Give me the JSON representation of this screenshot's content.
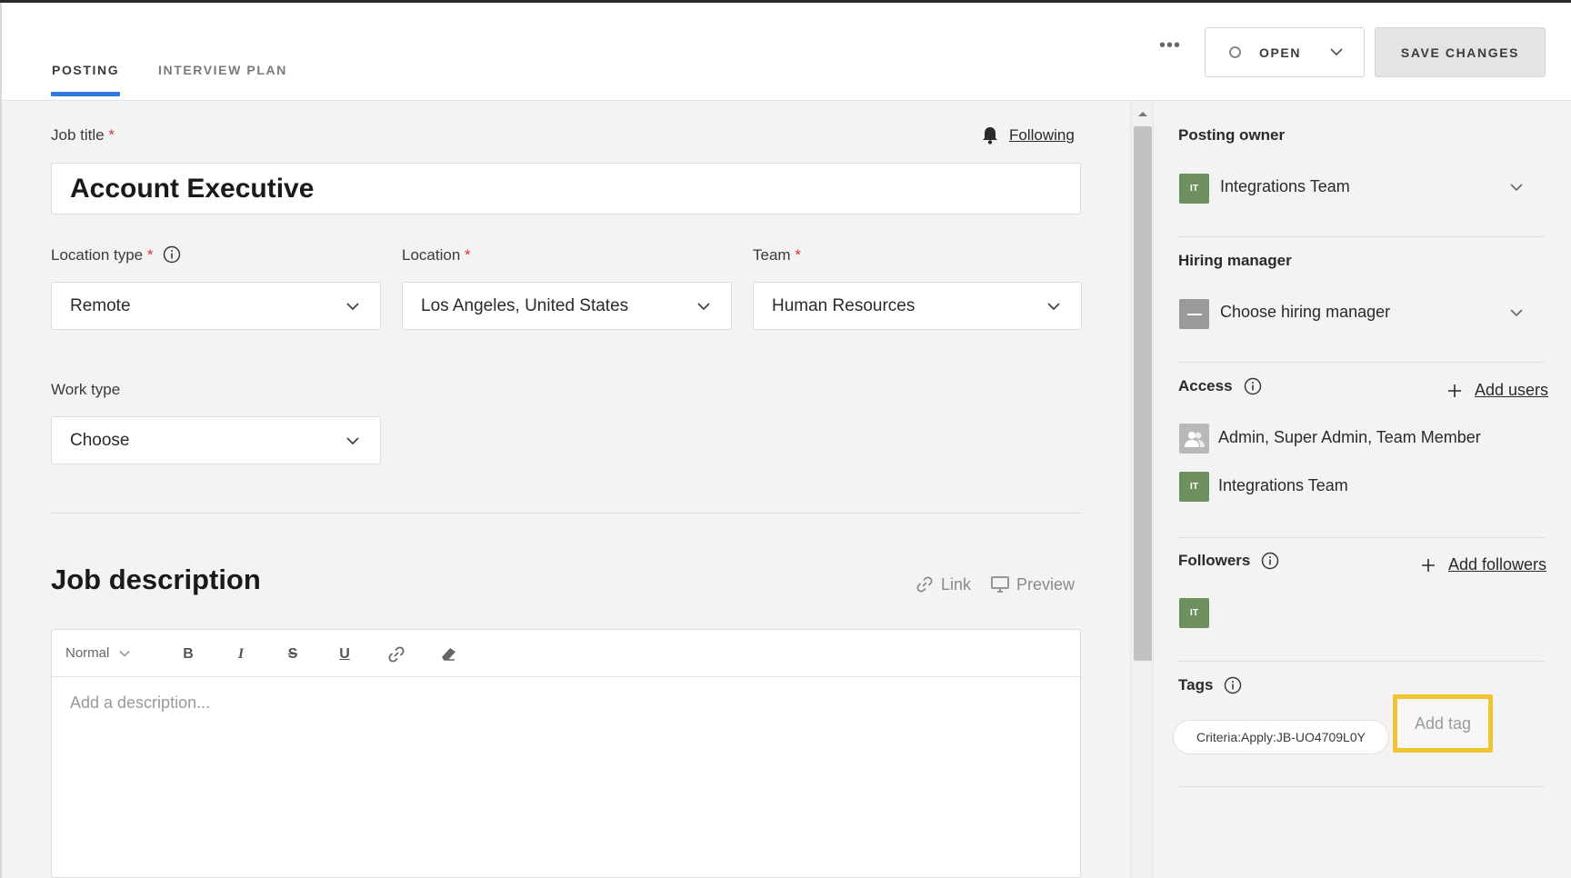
{
  "tabs": [
    {
      "label": "POSTING",
      "active": true
    },
    {
      "label": "INTERVIEW PLAN",
      "active": false
    }
  ],
  "header": {
    "more": "•••",
    "status": "OPEN",
    "save": "SAVE CHANGES"
  },
  "form": {
    "job_title_label": "Job title",
    "required_mark": "*",
    "following": "Following",
    "job_title_value": "Account Executive",
    "location_type_label": "Location type",
    "location_type_value": "Remote",
    "location_label": "Location",
    "location_value": "Los Angeles, United States",
    "team_label": "Team",
    "team_value": "Human Resources",
    "work_type_label": "Work type",
    "work_type_value": "Choose"
  },
  "description": {
    "title": "Job description",
    "link": "Link",
    "preview": "Preview",
    "format": "Normal",
    "bold": "B",
    "italic": "I",
    "strike": "S",
    "underline": "U",
    "placeholder": "Add a description..."
  },
  "sidebar": {
    "posting_owner_label": "Posting owner",
    "posting_owner_initials": "IT",
    "posting_owner_value": "Integrations Team",
    "hiring_manager_label": "Hiring manager",
    "hiring_manager_value": "Choose hiring manager",
    "access_label": "Access",
    "add_users": "Add users",
    "access_items": [
      {
        "text": "Admin, Super Admin, Team Member"
      },
      {
        "initials": "IT",
        "text": "Integrations Team"
      }
    ],
    "followers_label": "Followers",
    "add_followers": "Add followers",
    "follower_initials": "IT",
    "tags_label": "Tags",
    "tag_value": "Criteria:Apply:JB-UO4709L0Y",
    "add_tag_placeholder": "Add tag"
  },
  "colors": {
    "accent": "#2d7ae0",
    "avatar": "#6e8f5e",
    "highlight": "#f1c232",
    "required": "#dd3333"
  }
}
